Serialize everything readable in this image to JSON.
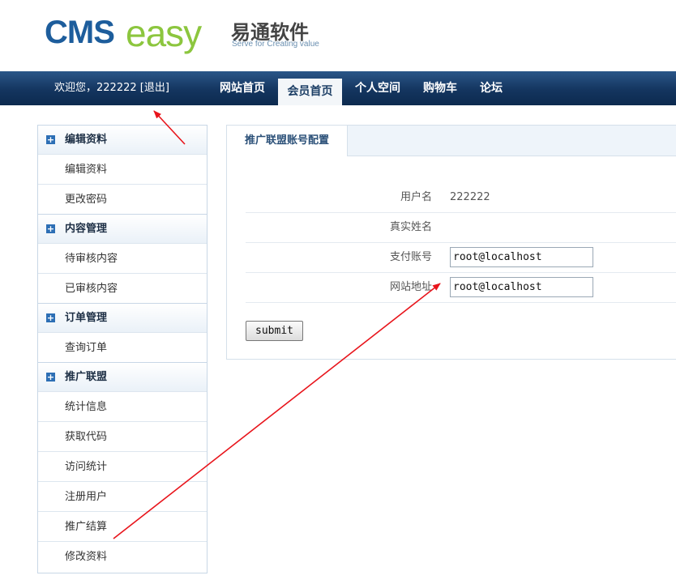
{
  "header": {
    "logo_cms": "CMS",
    "logo_easy": "easy",
    "logo_cn": "易通软件",
    "logo_sub": "Serve for Creating value"
  },
  "navbar": {
    "welcome": "欢迎您，222222 [退出]",
    "items": [
      {
        "label": "网站首页",
        "active": false
      },
      {
        "label": "会员首页",
        "active": true
      },
      {
        "label": "个人空间",
        "active": false
      },
      {
        "label": "购物车",
        "active": false
      },
      {
        "label": "论坛",
        "active": false
      }
    ]
  },
  "sidebar": {
    "groups": [
      {
        "title": "编辑资料",
        "items": [
          "编辑资料",
          "更改密码"
        ]
      },
      {
        "title": "内容管理",
        "items": [
          "待审核内容",
          "已审核内容"
        ]
      },
      {
        "title": "订单管理",
        "items": [
          "查询订单"
        ]
      },
      {
        "title": "推广联盟",
        "items": [
          "统计信息",
          "获取代码",
          "访问统计",
          "注册用户",
          "推广结算",
          "修改资料"
        ]
      }
    ]
  },
  "main": {
    "tab": "推广联盟账号配置",
    "fields": {
      "username_label": "用户名",
      "username_value": "222222",
      "realname_label": "真实姓名",
      "pay_label": "支付账号",
      "pay_value": "root@localhost",
      "site_label": "网站地址",
      "site_value": "root@localhost"
    },
    "submit_label": "submit"
  },
  "colors": {
    "navbar": "#14355f",
    "annotation_arrow": "#e8141b",
    "logo_blue": "#1d5d9c",
    "logo_green": "#8cc63e"
  }
}
